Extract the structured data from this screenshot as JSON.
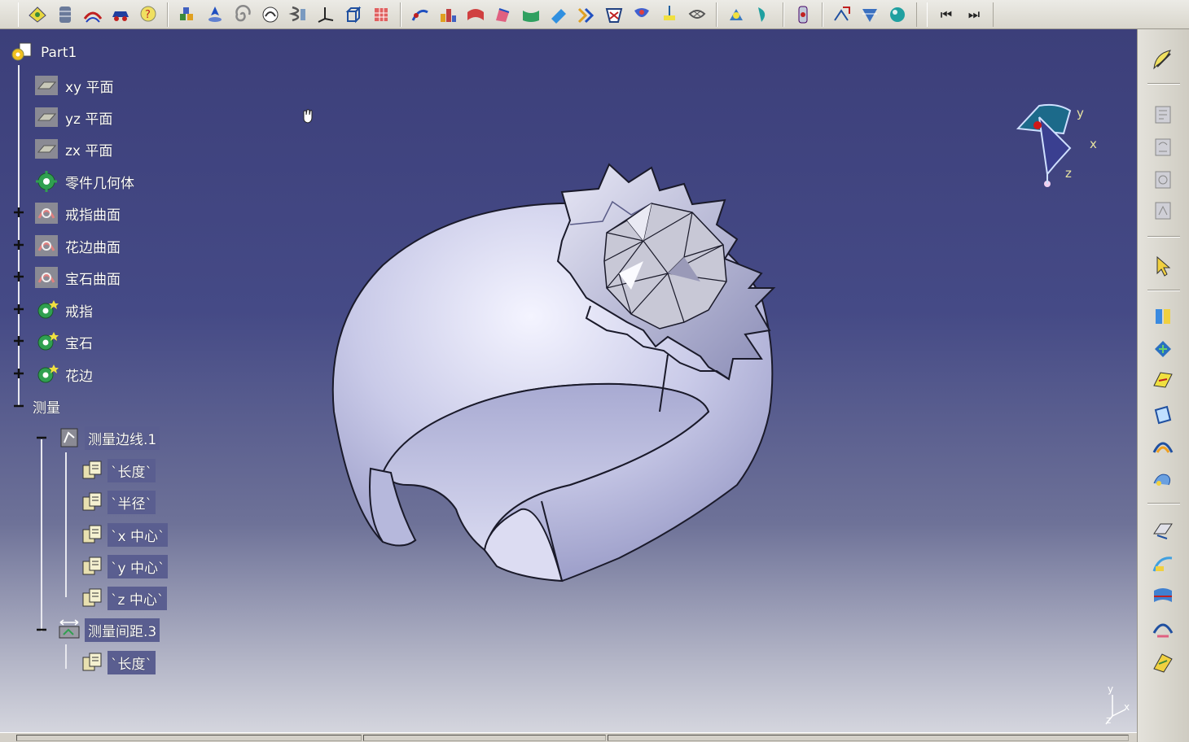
{
  "toolbar": {
    "top_icons": [
      "sketcher-icon",
      "multi-sections-icon",
      "loft-icon",
      "car-icon",
      "help-icon",
      "catalog-icon",
      "point-icon",
      "spiral-icon",
      "spline-icon",
      "helix-icon",
      "axis-system-icon",
      "cube-icon",
      "grid-icon",
      "extrude-icon",
      "revolve-icon",
      "sweep-icon",
      "fill-icon",
      "blend-icon",
      "offset-icon",
      "extract-icon",
      "join-icon",
      "split-icon",
      "trim-icon",
      "measure-icon",
      "transform-icon",
      "symmetry-icon",
      "rotate-icon",
      "scale-icon",
      "analysis-icon",
      "law-icon",
      "sphere-icon"
    ],
    "nav_first": "⏮",
    "nav_last": "⏭"
  },
  "tree": {
    "root": "Part1",
    "planes": [
      "xy 平面",
      "yz 平面",
      "zx 平面"
    ],
    "part_body": "零件几何体",
    "surfaces": [
      "戒指曲面",
      "花边曲面",
      "宝石曲面"
    ],
    "bodies": [
      "戒指",
      "宝石",
      "花边"
    ],
    "measure_group": "测量",
    "measure_edge": "测量边线.1",
    "edge_params": [
      "`长度`",
      "`半径`",
      "`x 中心`",
      "`y 中心`",
      "`z 中心`"
    ],
    "measure_distance": "测量间距.3",
    "distance_params": [
      "`长度`"
    ]
  },
  "compass": {
    "x_label": "x",
    "y_label": "y",
    "z_label": "z"
  },
  "mini_axis": {
    "y_label": "y",
    "x_label": "x",
    "z_label": "z"
  },
  "right_toolbar": {
    "icons": [
      "sketch-pen-icon",
      "constraint-icon",
      "constraint-2-icon",
      "constraint-3-icon",
      "constraint-4-icon",
      "select-arrow-icon",
      "surface-a-icon",
      "surface-b-icon",
      "surface-c-icon",
      "surface-d-icon",
      "surface-e-icon",
      "surface-f-icon",
      "plane-icon",
      "curve-a-icon",
      "curve-b-icon",
      "curve-c-icon",
      "curve-d-icon"
    ]
  },
  "colors": {
    "viewport_top": "#3c3f7a",
    "ring_body": "#c9cae8",
    "ring_shadow": "#8e90bf"
  }
}
